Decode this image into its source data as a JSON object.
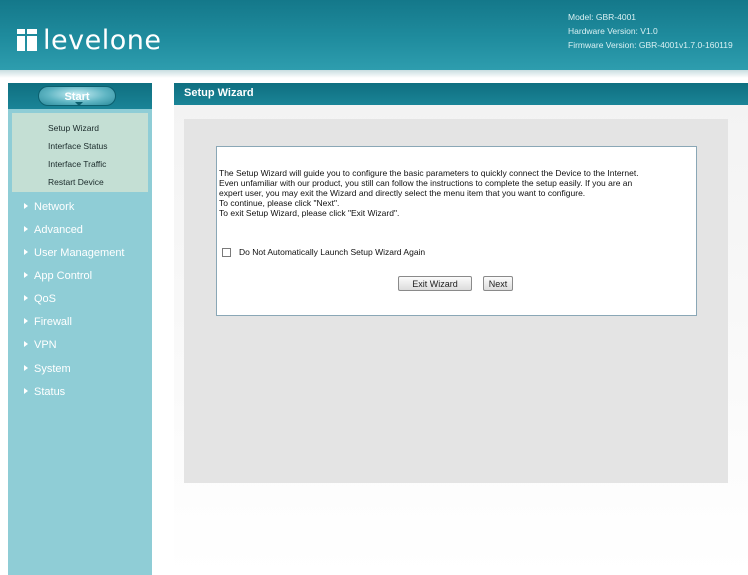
{
  "header": {
    "logo_text": "levelone",
    "model": "Model: GBR-4001",
    "hardware_version": "Hardware Version: V1.0",
    "firmware_version": "Firmware Version: GBR-4001v1.7.0-160119"
  },
  "sidebar": {
    "start_label": "Start",
    "submenu": [
      "Setup Wizard",
      "Interface Status",
      "Interface Traffic",
      "Restart Device"
    ],
    "nav": [
      "Network",
      "Advanced",
      "User Management",
      "App Control",
      "QoS",
      "Firewall",
      "VPN",
      "System",
      "Status"
    ]
  },
  "main": {
    "title": "Setup Wizard",
    "text_lines": [
      "The Setup Wizard will guide you to configure the basic parameters to quickly connect the Device to the Internet.",
      "Even unfamiliar with our product, you still can follow the instructions to complete the setup easily. If you are an",
      "expert user, you may exit the Wizard and directly select the menu item that you want to configure.",
      "To continue, please click \"Next\".",
      "To exit Setup Wizard, please click \"Exit Wizard\"."
    ],
    "checkbox_label": "Do Not Automatically Launch Setup Wizard Again",
    "checkbox_checked": false,
    "exit_button": "Exit Wizard",
    "next_button": "Next"
  },
  "colors": {
    "header": "#1f8c9e",
    "sidebar": "#8fcdd6",
    "submenu_bg": "#c4dfd4",
    "title_bar": "#157a8b"
  }
}
